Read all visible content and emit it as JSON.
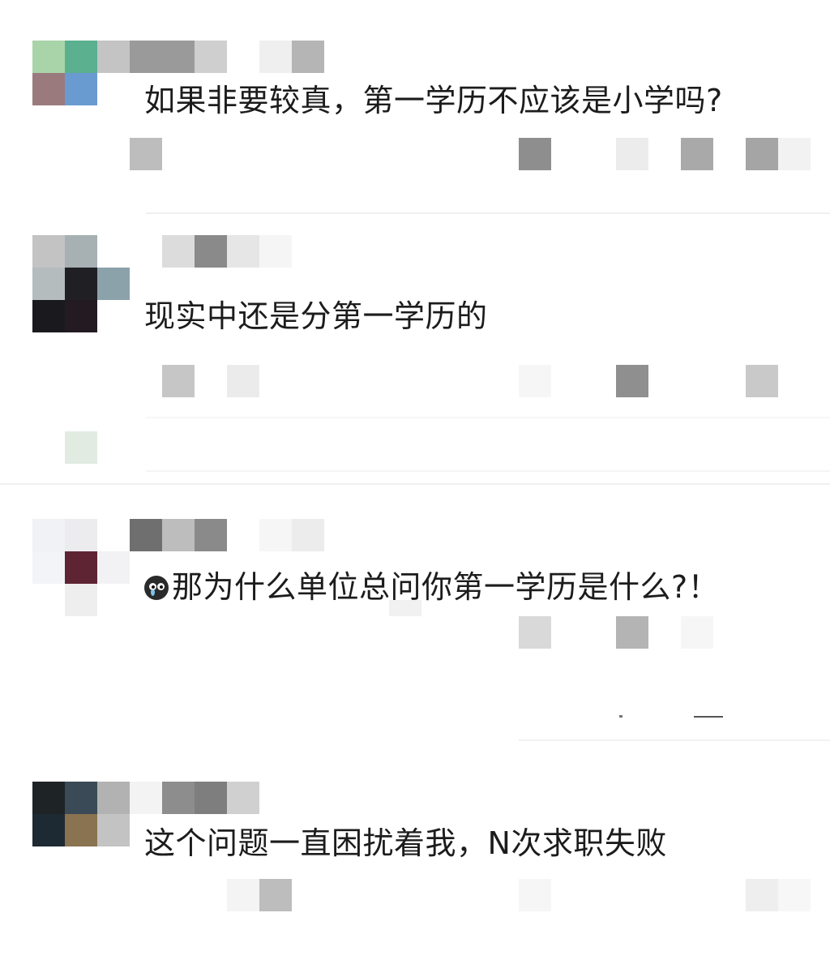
{
  "comments": [
    {
      "text": "如果非要较真，第一学历不应该是小学吗?"
    },
    {
      "text": "现实中还是分第一学历的"
    },
    {
      "emoji_icon": "cry-face-icon",
      "text": "那为什么单位总问你第一学历是什么?！"
    },
    {
      "text": "这个问题一直困扰着我，N次求职失败"
    }
  ],
  "colors": {
    "text": "#1c1c1c",
    "divider": "#f0f0f0",
    "background": "#ffffff"
  }
}
